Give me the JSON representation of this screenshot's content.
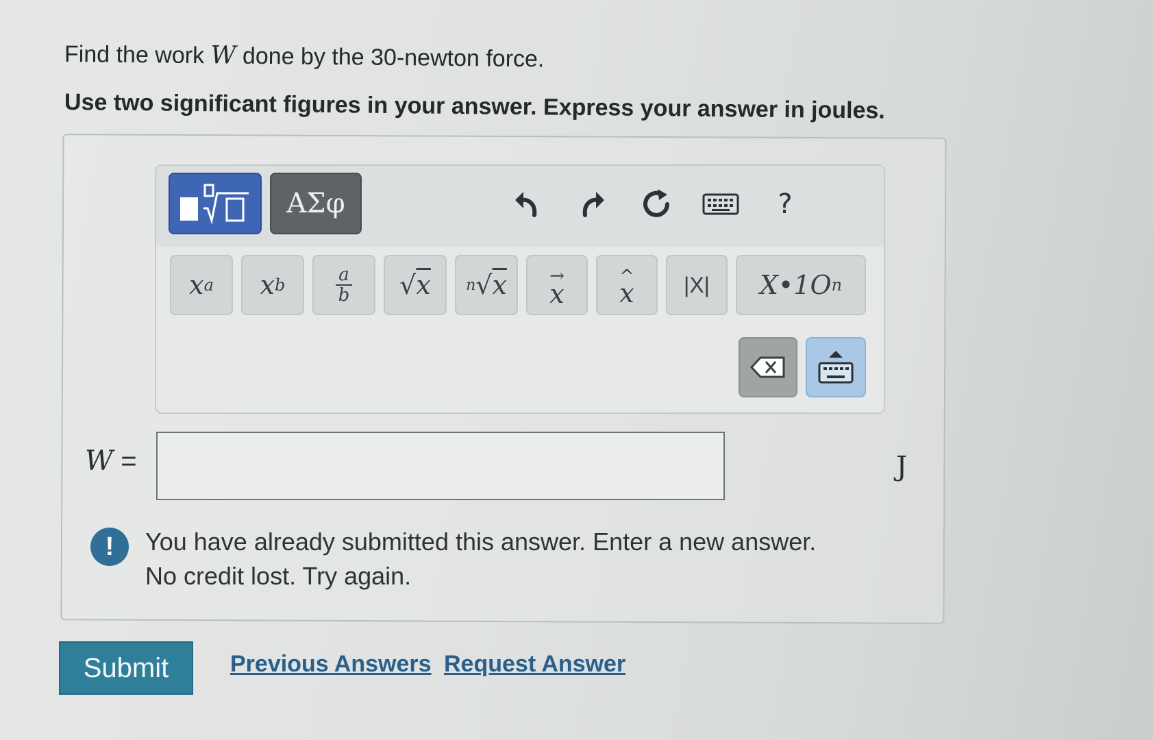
{
  "question": {
    "line1_pre": "Find the work ",
    "line1_var": "W",
    "line1_post": " done by the 30-newton force.",
    "instruction": "Use two significant figures in your answer. Express your answer in joules."
  },
  "toolbar": {
    "greek_label": "ΑΣφ",
    "undo_icon": "undo-icon",
    "redo_icon": "redo-icon",
    "reset_icon": "reset-icon",
    "keyboard_icon": "keyboard-icon",
    "help_label": "?",
    "math_buttons": [
      {
        "name": "superscript-button",
        "label": "xa"
      },
      {
        "name": "subscript-button",
        "label": "xb"
      },
      {
        "name": "fraction-button",
        "label": "a/b"
      },
      {
        "name": "sqrt-button",
        "label": "√x"
      },
      {
        "name": "nth-root-button",
        "label": "n√x"
      },
      {
        "name": "vector-button",
        "label": "x→"
      },
      {
        "name": "unit-vector-button",
        "label": "x^"
      },
      {
        "name": "abs-button",
        "label": "|x|"
      },
      {
        "name": "sci-notation-button",
        "label": "x·10n"
      }
    ]
  },
  "answer": {
    "label_var": "W",
    "label_eq": " =",
    "value": "",
    "unit": "J"
  },
  "warning": {
    "icon": "!",
    "line1": "You have already submitted this answer. Enter a new answer.",
    "line2": "No credit lost. Try again."
  },
  "actions": {
    "submit": "Submit",
    "previous": "Previous Answers",
    "request": "Request Answer"
  }
}
